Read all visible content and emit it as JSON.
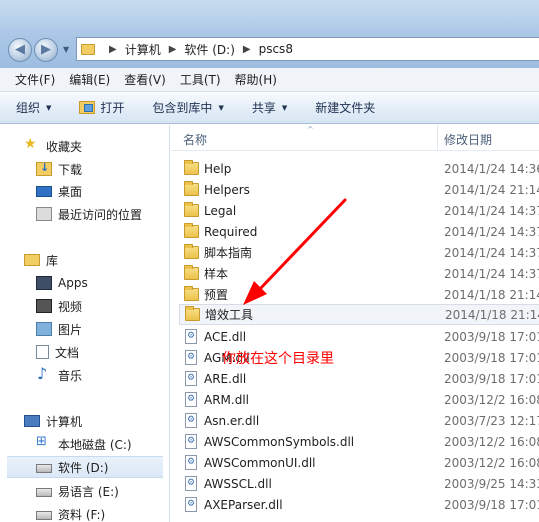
{
  "address": {
    "crumbs": [
      "计算机",
      "软件 (D:)",
      "pscs8"
    ]
  },
  "menu": [
    "文件(F)",
    "编辑(E)",
    "查看(V)",
    "工具(T)",
    "帮助(H)"
  ],
  "toolbar": {
    "organize": "组织",
    "open": "打开",
    "include_in_library": "包含到库中",
    "share": "共享",
    "new_folder": "新建文件夹"
  },
  "navpane": {
    "favorites": "收藏夹",
    "downloads": "下载",
    "desktop": "桌面",
    "recent": "最近访问的位置",
    "libraries": "库",
    "apps": "Apps",
    "video": "视频",
    "pictures": "图片",
    "documents": "文档",
    "music": "音乐",
    "computer": "计算机",
    "local_disk": "本地磁盘 (C:)",
    "software_disk": "软件 (D:)",
    "easy_lang": "易语言 (E:)",
    "data_disk": "资料 (F:)"
  },
  "columns": {
    "name": "名称",
    "date": "修改日期"
  },
  "files": [
    {
      "name": "Help",
      "date": "2014/1/24 14:36",
      "type": "folder"
    },
    {
      "name": "Helpers",
      "date": "2014/1/24 21:14",
      "type": "folder"
    },
    {
      "name": "Legal",
      "date": "2014/1/24 14:37",
      "type": "folder"
    },
    {
      "name": "Required",
      "date": "2014/1/24 14:37",
      "type": "folder"
    },
    {
      "name": "脚本指南",
      "date": "2014/1/24 14:37",
      "type": "folder"
    },
    {
      "name": "样本",
      "date": "2014/1/24 14:37",
      "type": "folder"
    },
    {
      "name": "预置",
      "date": "2014/1/18 21:14",
      "type": "folder"
    },
    {
      "name": "增效工具",
      "date": "2014/1/18 21:14",
      "type": "folder"
    },
    {
      "name": "ACE.dll",
      "date": "2003/9/18 17:01",
      "type": "dll"
    },
    {
      "name": "AGM.dll",
      "date": "2003/9/18 17:01",
      "type": "dll"
    },
    {
      "name": "ARE.dll",
      "date": "2003/9/18 17:01",
      "type": "dll"
    },
    {
      "name": "ARM.dll",
      "date": "2003/12/2 16:08",
      "type": "dll"
    },
    {
      "name": "Asn.er.dll",
      "date": "2003/7/23 12:17",
      "type": "dll"
    },
    {
      "name": "AWSCommonSymbols.dll",
      "date": "2003/12/2 16:08",
      "type": "dll"
    },
    {
      "name": "AWSCommonUI.dll",
      "date": "2003/12/2 16:08",
      "type": "dll"
    },
    {
      "name": "AWSSCL.dll",
      "date": "2003/9/25 14:33",
      "type": "dll"
    },
    {
      "name": "AXEParser.dll",
      "date": "2003/9/18 17:01",
      "type": "dll"
    }
  ],
  "annotation": {
    "text": "你放在这个目录里",
    "color": "#ff0000"
  }
}
